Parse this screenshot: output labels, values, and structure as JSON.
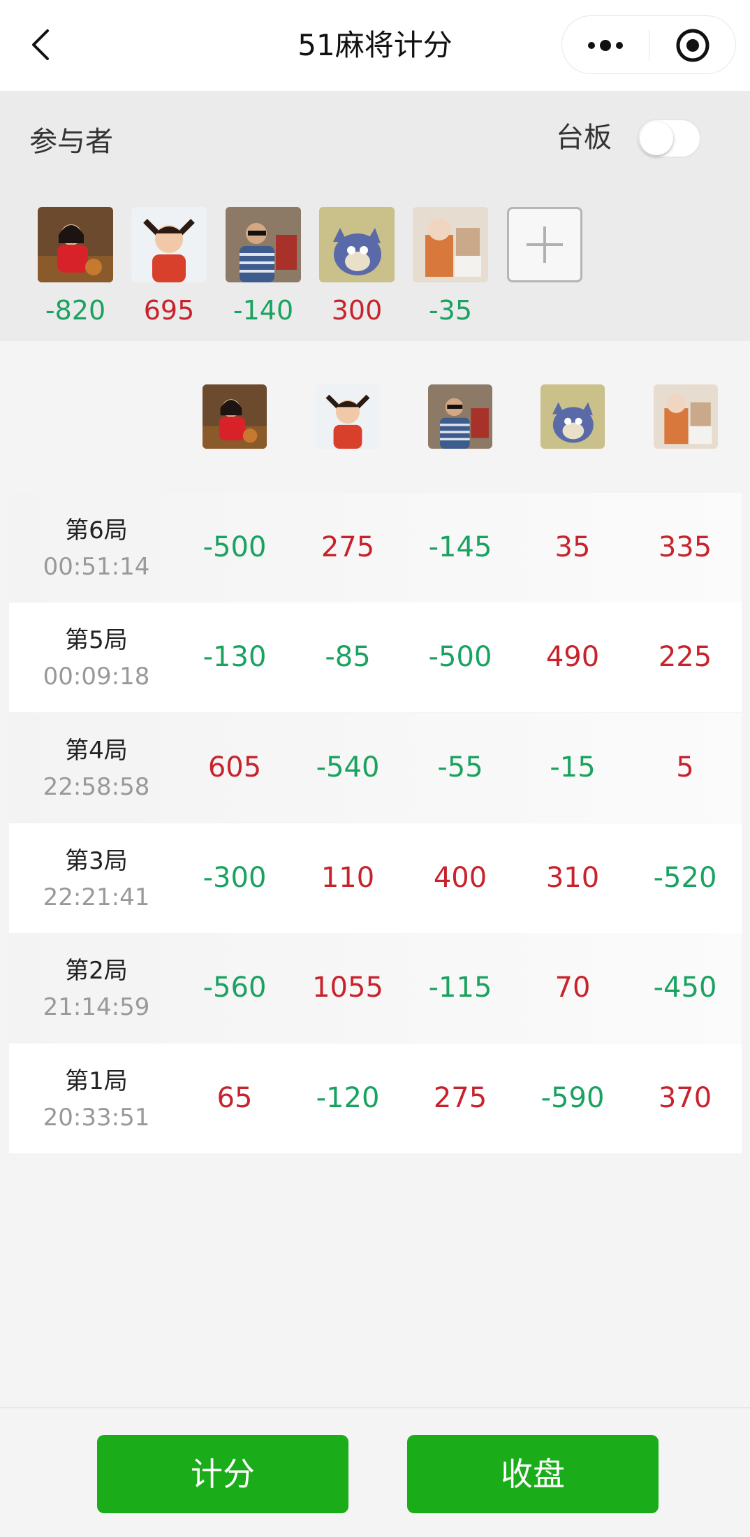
{
  "header": {
    "title": "51麻将计分"
  },
  "participants": {
    "section_label": "参与者",
    "board_label": "台板",
    "board_enabled": false,
    "players": [
      {
        "id": "p1",
        "total": "-820",
        "sign": "neg",
        "avatar": "avatar-girl-red-coat"
      },
      {
        "id": "p2",
        "total": "695",
        "sign": "pos",
        "avatar": "avatar-child-pigtails"
      },
      {
        "id": "p3",
        "total": "-140",
        "sign": "neg",
        "avatar": "avatar-man-sunglasses"
      },
      {
        "id": "p4",
        "total": "300",
        "sign": "pos",
        "avatar": "avatar-cartoon-cat"
      },
      {
        "id": "p5",
        "total": "-35",
        "sign": "neg",
        "avatar": "avatar-doll-chair"
      }
    ]
  },
  "rounds": [
    {
      "name": "第6局",
      "time": "00:51:14",
      "scores": [
        "-500",
        "275",
        "-145",
        "35",
        "335"
      ]
    },
    {
      "name": "第5局",
      "time": "00:09:18",
      "scores": [
        "-130",
        "-85",
        "-500",
        "490",
        "225"
      ]
    },
    {
      "name": "第4局",
      "time": "22:58:58",
      "scores": [
        "605",
        "-540",
        "-55",
        "-15",
        "5"
      ]
    },
    {
      "name": "第3局",
      "time": "22:21:41",
      "scores": [
        "-300",
        "110",
        "400",
        "310",
        "-520"
      ]
    },
    {
      "name": "第2局",
      "time": "21:14:59",
      "scores": [
        "-560",
        "1055",
        "-115",
        "70",
        "-450"
      ]
    },
    {
      "name": "第1局",
      "time": "20:33:51",
      "scores": [
        "65",
        "-120",
        "275",
        "-590",
        "370"
      ]
    }
  ],
  "footer": {
    "score_button": "计分",
    "close_button": "收盘"
  },
  "colors": {
    "positive": "#c8232c",
    "negative": "#1aa260",
    "button": "#1aad19"
  }
}
